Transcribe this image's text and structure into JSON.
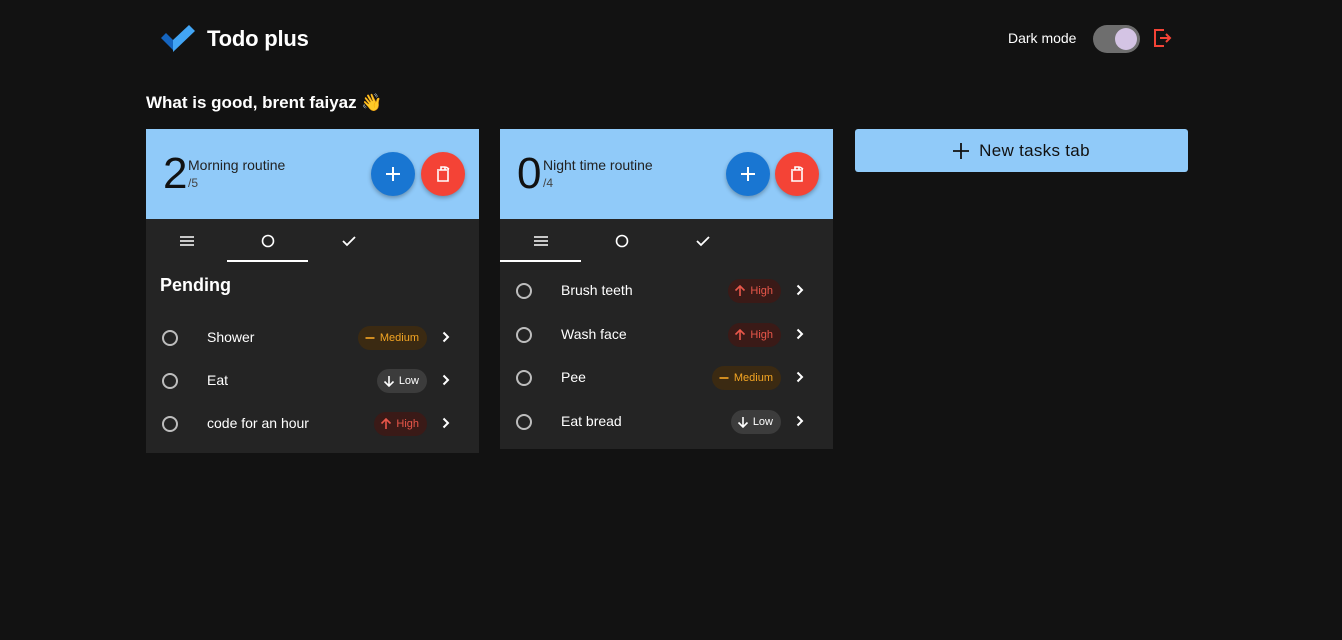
{
  "header": {
    "app_title": "Todo plus",
    "dark_mode_label": "Dark mode",
    "dark_mode_on": true
  },
  "greeting": "What is good, brent faiyaz 👋",
  "colors": {
    "accent": "#90caf9",
    "add_button": "#1976d2",
    "delete_button": "#f44336",
    "background": "#121212",
    "card": "#242424"
  },
  "tabs_cards": [
    {
      "count": "2",
      "title": "Morning routine",
      "total": "/5",
      "active_tab": "pending",
      "section_title": "Pending",
      "tasks": [
        {
          "name": "Shower",
          "priority": "Medium"
        },
        {
          "name": "Eat",
          "priority": "Low"
        },
        {
          "name": "code for an hour",
          "priority": "High"
        }
      ]
    },
    {
      "count": "0",
      "title": "Night time routine",
      "total": "/4",
      "active_tab": "all",
      "section_title": "",
      "tasks": [
        {
          "name": "Brush teeth",
          "priority": "High"
        },
        {
          "name": "Wash face",
          "priority": "High"
        },
        {
          "name": "Pee",
          "priority": "Medium"
        },
        {
          "name": "Eat bread",
          "priority": "Low"
        }
      ]
    }
  ],
  "new_tab_button": "New tasks tab"
}
